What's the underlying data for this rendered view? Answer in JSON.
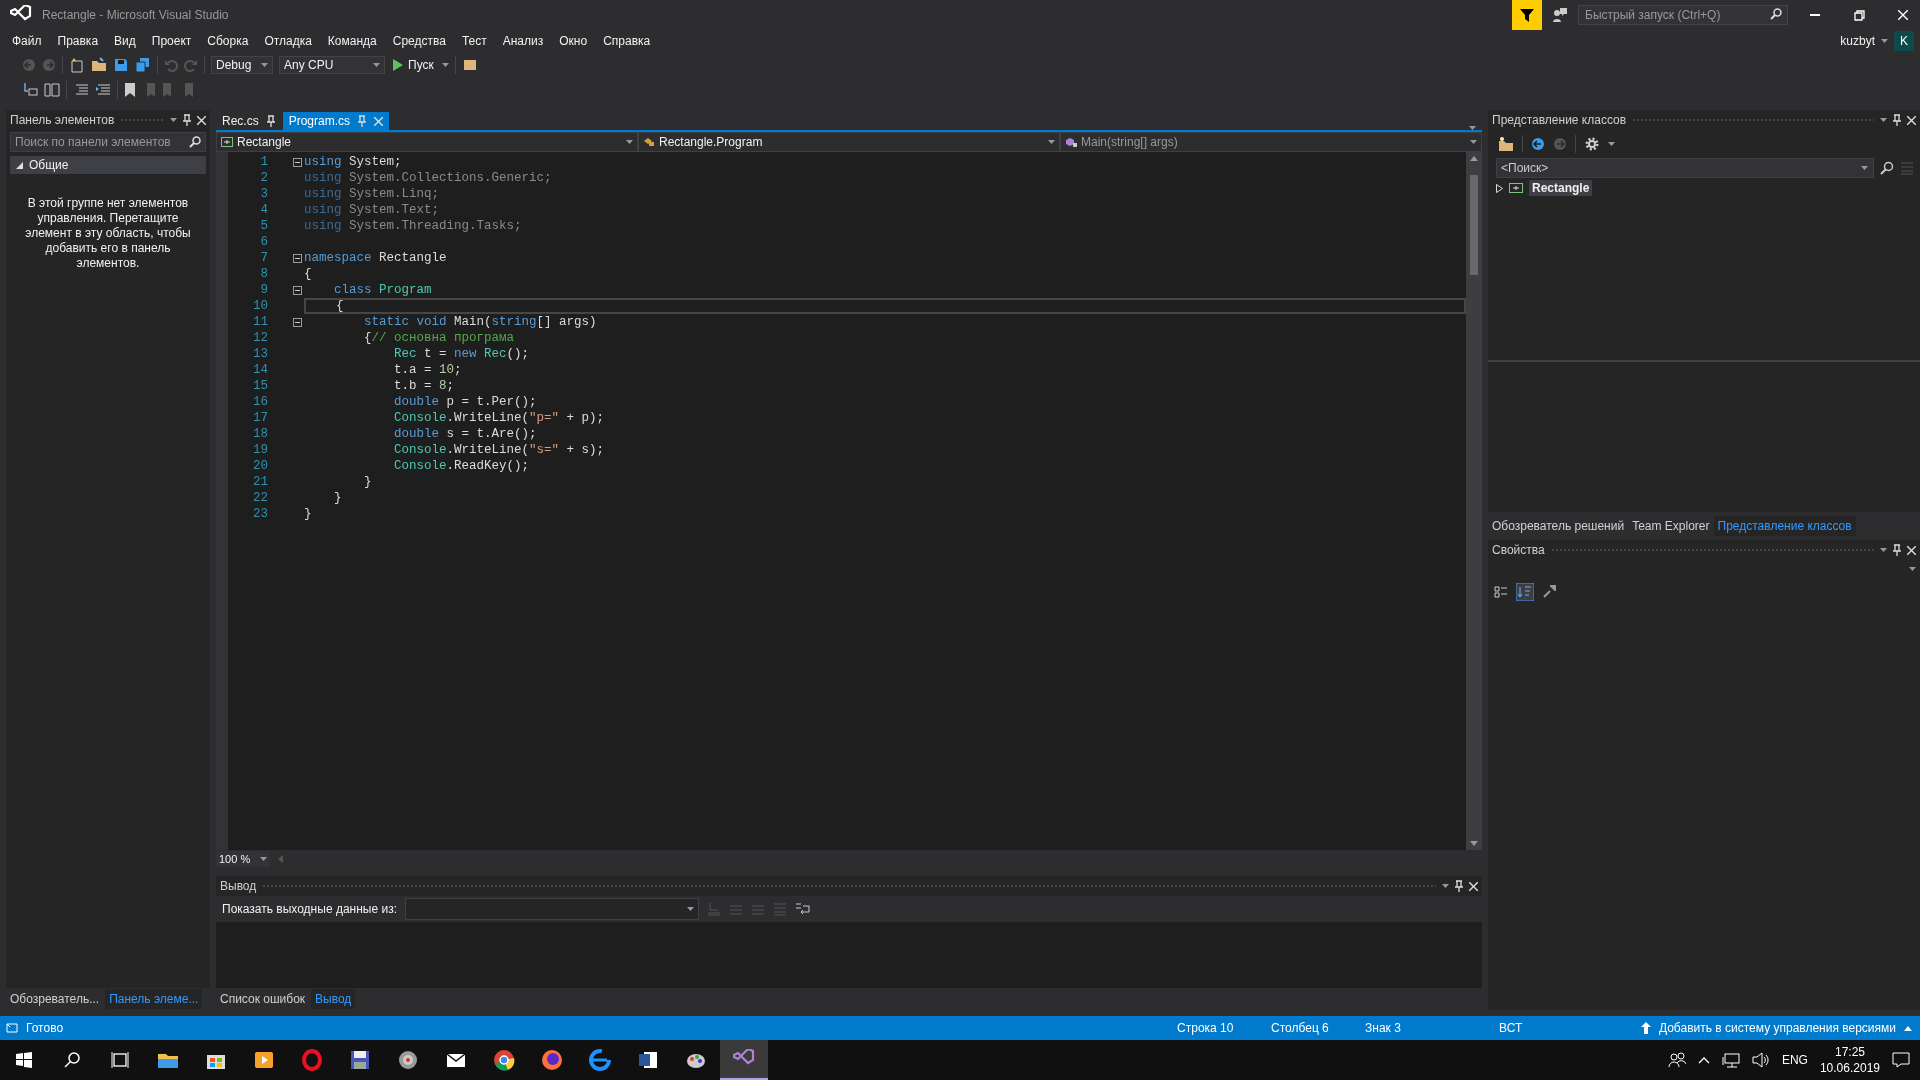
{
  "window": {
    "title": "Rectangle - Microsoft Visual Studio",
    "quick_launch": {
      "placeholder": "Быстрый запуск (Ctrl+Q)"
    },
    "user": "kuzbyt",
    "avatar": "K"
  },
  "menu": [
    "Файл",
    "Правка",
    "Вид",
    "Проект",
    "Сборка",
    "Отладка",
    "Команда",
    "Средства",
    "Тест",
    "Анализ",
    "Окно",
    "Справка"
  ],
  "toolbar": {
    "configuration": "Debug",
    "platform": "Any CPU",
    "run": "Пуск"
  },
  "toolbox": {
    "title": "Панель элементов",
    "search": {
      "placeholder": "Поиск по панели элементов"
    },
    "group": "Общие",
    "expanded": true,
    "empty_message": "В этой группе нет элементов управления. Перетащите элемент в эту область, чтобы добавить его в панель элементов.",
    "tabs": [
      {
        "label": "Обозреватель...",
        "selected": false
      },
      {
        "label": "Панель элеме...",
        "selected": true
      }
    ]
  },
  "editor": {
    "tabs": [
      {
        "label": "Rec.cs",
        "selected": false
      },
      {
        "label": "Program.cs",
        "selected": true
      }
    ],
    "nav": [
      "Rectangle",
      "Rectangle.Program",
      "Main(string[] args)"
    ],
    "lines": [
      {
        "number": "1",
        "fold": true,
        "current": false,
        "tokens": [
          {
            "kind": "keyword",
            "text": "using"
          },
          {
            "kind": "plain",
            "text": " System;"
          }
        ]
      },
      {
        "number": "2",
        "fold": false,
        "current": false,
        "tokens": [
          {
            "kind": "unused_keyword",
            "text": "using"
          },
          {
            "kind": "unused",
            "text": " System.Collections.Generic;"
          }
        ]
      },
      {
        "number": "3",
        "fold": false,
        "current": false,
        "tokens": [
          {
            "kind": "unused_keyword",
            "text": "using"
          },
          {
            "kind": "unused",
            "text": " System.Linq;"
          }
        ]
      },
      {
        "number": "4",
        "fold": false,
        "current": false,
        "tokens": [
          {
            "kind": "unused_keyword",
            "text": "using"
          },
          {
            "kind": "unused",
            "text": " System.Text;"
          }
        ]
      },
      {
        "number": "5",
        "fold": false,
        "current": false,
        "tokens": [
          {
            "kind": "unused_keyword",
            "text": "using"
          },
          {
            "kind": "unused",
            "text": " System.Threading.Tasks;"
          }
        ]
      },
      {
        "number": "6",
        "fold": false,
        "current": false
      },
      {
        "number": "7",
        "fold": true,
        "current": false,
        "tokens": [
          {
            "kind": "keyword",
            "text": "namespace"
          },
          {
            "kind": "plain",
            "text": " Rectangle"
          }
        ]
      },
      {
        "number": "8",
        "fold": false,
        "current": false,
        "tokens": [
          {
            "kind": "plain",
            "text": "{"
          }
        ]
      },
      {
        "number": "9",
        "fold": true,
        "current": false,
        "tokens": [
          {
            "kind": "keyword",
            "text": "    class"
          },
          {
            "kind": "type",
            "text": " Program"
          }
        ]
      },
      {
        "number": "10",
        "fold": false,
        "current": true,
        "tokens": [
          {
            "kind": "plain",
            "text": "    {"
          }
        ]
      },
      {
        "number": "11",
        "fold": true,
        "current": false,
        "tokens": [
          {
            "kind": "keyword",
            "text": "        static"
          },
          {
            "kind": "keyword",
            "text": " void"
          },
          {
            "kind": "plain",
            "text": " Main("
          },
          {
            "kind": "keyword",
            "text": "string"
          },
          {
            "kind": "plain",
            "text": "[] args)"
          }
        ]
      },
      {
        "number": "12",
        "fold": false,
        "current": false,
        "tokens": [
          {
            "kind": "plain",
            "text": "        {"
          },
          {
            "kind": "comment",
            "text": "// основна програма"
          }
        ]
      },
      {
        "number": "13",
        "fold": false,
        "current": false,
        "tokens": [
          {
            "kind": "type",
            "text": "            Rec"
          },
          {
            "kind": "plain",
            "text": " t = "
          },
          {
            "kind": "keyword",
            "text": "new"
          },
          {
            "kind": "type",
            "text": " Rec"
          },
          {
            "kind": "plain",
            "text": "();"
          }
        ]
      },
      {
        "number": "14",
        "fold": false,
        "current": false,
        "tokens": [
          {
            "kind": "plain",
            "text": "            t.a = "
          },
          {
            "kind": "number",
            "text": "10"
          },
          {
            "kind": "plain",
            "text": ";"
          }
        ]
      },
      {
        "number": "15",
        "fold": false,
        "current": false,
        "tokens": [
          {
            "kind": "plain",
            "text": "            t.b = "
          },
          {
            "kind": "number",
            "text": "8"
          },
          {
            "kind": "plain",
            "text": ";"
          }
        ]
      },
      {
        "number": "16",
        "fold": false,
        "current": false,
        "tokens": [
          {
            "kind": "keyword",
            "text": "            double"
          },
          {
            "kind": "plain",
            "text": " p = t.Per();"
          }
        ]
      },
      {
        "number": "17",
        "fold": false,
        "current": false,
        "tokens": [
          {
            "kind": "type",
            "text": "            Console"
          },
          {
            "kind": "plain",
            "text": ".WriteLine("
          },
          {
            "kind": "string",
            "text": "\"p=\""
          },
          {
            "kind": "plain",
            "text": " + p);"
          }
        ]
      },
      {
        "number": "18",
        "fold": false,
        "current": false,
        "tokens": [
          {
            "kind": "keyword",
            "text": "            double"
          },
          {
            "kind": "plain",
            "text": " s = t.Are();"
          }
        ]
      },
      {
        "number": "19",
        "fold": false,
        "current": false,
        "tokens": [
          {
            "kind": "type",
            "text": "            Console"
          },
          {
            "kind": "plain",
            "text": ".WriteLine("
          },
          {
            "kind": "string",
            "text": "\"s=\""
          },
          {
            "kind": "plain",
            "text": " + s);"
          }
        ]
      },
      {
        "number": "20",
        "fold": false,
        "current": false,
        "tokens": [
          {
            "kind": "type",
            "text": "            Console"
          },
          {
            "kind": "plain",
            "text": ".ReadKey();"
          }
        ]
      },
      {
        "number": "21",
        "fold": false,
        "current": false,
        "tokens": [
          {
            "kind": "plain",
            "text": "        }"
          }
        ]
      },
      {
        "number": "22",
        "fold": false,
        "current": false,
        "tokens": [
          {
            "kind": "plain",
            "text": "    }"
          }
        ]
      },
      {
        "number": "23",
        "fold": false,
        "current": false,
        "tokens": [
          {
            "kind": "plain",
            "text": "}"
          }
        ]
      }
    ],
    "zoom": "100 %"
  },
  "output": {
    "title": "Вывод",
    "source_label": "Показать выходные данные из:",
    "tabs": [
      {
        "label": "Список ошибок",
        "selected": false
      },
      {
        "label": "Вывод",
        "selected": true
      }
    ]
  },
  "class_view": {
    "title": "Представление классов",
    "search": {
      "placeholder": "<Поиск>"
    },
    "tree": [
      {
        "label": "Rectangle",
        "expanded": false
      }
    ],
    "tabs": [
      {
        "label": "Обозреватель решений",
        "selected": false
      },
      {
        "label": "Team Explorer",
        "selected": false
      },
      {
        "label": "Представление классов",
        "selected": true
      }
    ]
  },
  "properties": {
    "title": "Свойства"
  },
  "status_bar": {
    "message": "Готово",
    "line": "Строка 10",
    "column": "Столбец 6",
    "char": "Знак 3",
    "mode": "ВСТ",
    "source_control": "Добавить в систему управления версиями"
  },
  "taskbar": {
    "language": "ENG",
    "time": "17:25",
    "date": "10.06.2019"
  }
}
